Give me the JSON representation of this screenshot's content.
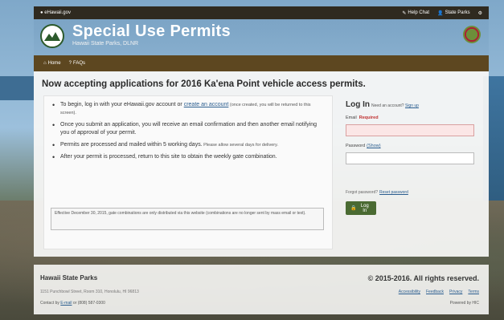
{
  "topbar": {
    "site_link": "eHawaii.gov",
    "help_chat": "Help Chat",
    "state_parks": "State Parks"
  },
  "header": {
    "title": "Special Use Permits",
    "subtitle": "Hawaii State Parks, DLNR"
  },
  "nav": {
    "home": "Home",
    "faqs": "FAQs"
  },
  "main": {
    "headline": "Now accepting applications for 2016 Ka'ena Point vehicle access permits.",
    "bullets": {
      "b1_text_a": "To begin, log in with your eHawaii.gov account or ",
      "b1_link": "create an account",
      "b1_text_b": " (once created, you will be returned to this screen).",
      "b2": "Once you submit an application, you will receive an email confirmation and then another email notifying you of approval of your permit.",
      "b3_main": "Permits are processed and mailed within 5 working days.",
      "b3_small": " Please allow several days for delivery.",
      "b4": "After your permit is processed, return to this site to obtain the weekly gate combination."
    },
    "notice": "Effective December 30, 2015, gate combinations are only distributed via this website (combinations are no longer sent by mass email or text)."
  },
  "login": {
    "heading": "Log In",
    "need_account": "Need an account?",
    "sign_up": "Sign up",
    "email_label": "Email",
    "required": "Required",
    "email_value": "",
    "password_label": "Password",
    "show": "(Show)",
    "forgot": "Forgot password?",
    "reset": "Reset password",
    "button": "Log In"
  },
  "footer": {
    "title": "Hawaii State Parks",
    "address": "1151 Punchbowl Street, Room 310, Honolulu, HI 96813",
    "contact_prefix": "Contact by ",
    "email_link": "E-mail",
    "contact_or": " or (808) 587-0300",
    "copyright": "© 2015-2016. All rights reserved.",
    "links": [
      "Accessibility",
      "Feedback",
      "Privacy",
      "Terms"
    ],
    "powered": "Powered by HIC"
  }
}
